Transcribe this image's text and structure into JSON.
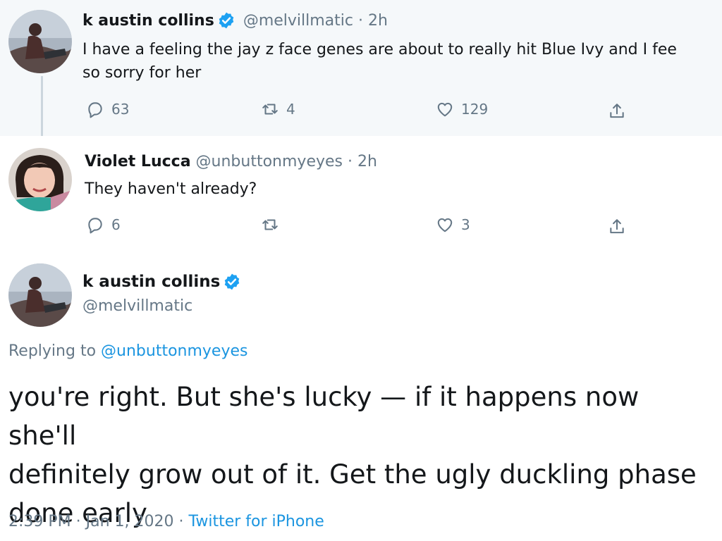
{
  "colors": {
    "accent": "#1da1f2",
    "link": "#1b95e0",
    "muted": "#657786",
    "text": "#14171a",
    "thread_bg": "#f5f8fa"
  },
  "tweets": [
    {
      "name": "k austin collins",
      "verified": true,
      "handle": "@melvillmatic",
      "sep": "·",
      "time": "2h",
      "text_lines": [
        "I have a feeling the jay z face genes are about to really hit Blue Ivy and I fee",
        "so sorry for her"
      ],
      "reply_count": "63",
      "retweet_count": "4",
      "like_count": "129",
      "icons": {
        "reply": "reply-icon",
        "retweet": "retweet-icon",
        "like": "heart-icon",
        "share": "share-icon"
      }
    },
    {
      "name": "Violet Lucca",
      "verified": false,
      "handle": "@unbuttonmyeyes",
      "sep": "·",
      "time": "2h",
      "text_lines": [
        "They haven't already?"
      ],
      "reply_count": "6",
      "retweet_count": "",
      "like_count": "3",
      "icons": {
        "reply": "reply-icon",
        "retweet": "retweet-icon",
        "like": "heart-icon",
        "share": "share-icon"
      }
    }
  ],
  "main_tweet": {
    "name": "k austin collins",
    "verified": true,
    "handle": "@melvillmatic",
    "replying_prefix": "Replying to",
    "replying_handle": "@unbuttonmyeyes",
    "text_lines": [
      "you're right. But she's lucky — if it happens now she'll",
      "definitely grow out of it. Get the ugly duckling phase",
      "done early"
    ],
    "time": "2:39 PM",
    "sep1": "·",
    "date": "Jan 1, 2020",
    "sep2": "·",
    "source": "Twitter for iPhone"
  }
}
